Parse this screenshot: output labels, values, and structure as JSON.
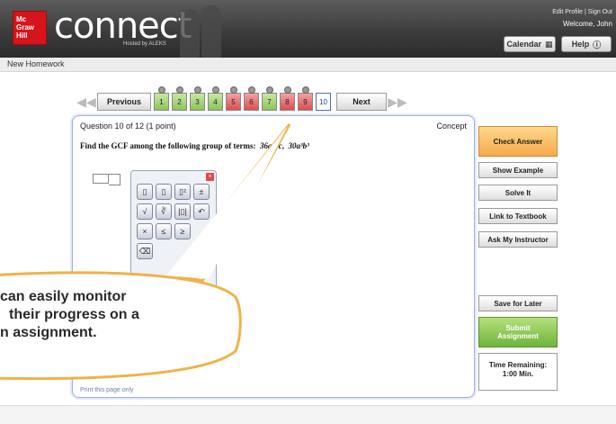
{
  "header": {
    "logo_line1": "Mc",
    "logo_line2": "Graw",
    "logo_line3": "Hill",
    "brand": "connect",
    "hosted": "Hosted by ALEKS",
    "links": "Edit Profile  |  Sign Out",
    "welcome": "Welcome, John",
    "calendar_label": "Calendar",
    "help_label": "Help"
  },
  "page_title": "New Homework",
  "nav": {
    "previous_label": "Previous",
    "next_label": "Next",
    "questions": [
      {
        "num": "1",
        "status": "green",
        "flag": true
      },
      {
        "num": "2",
        "status": "green",
        "flag": true
      },
      {
        "num": "3",
        "status": "green",
        "flag": true
      },
      {
        "num": "4",
        "status": "green",
        "flag": true
      },
      {
        "num": "5",
        "status": "red",
        "flag": true
      },
      {
        "num": "6",
        "status": "red",
        "flag": true
      },
      {
        "num": "7",
        "status": "green",
        "flag": true
      },
      {
        "num": "8",
        "status": "red",
        "flag": true
      },
      {
        "num": "9",
        "status": "red",
        "flag": true
      },
      {
        "num": "10",
        "status": "current",
        "flag": false
      }
    ]
  },
  "question": {
    "number_text": "Question 10 of 12 (1 point)",
    "concept_label": "Concept",
    "prompt": "Find the GCF among the following group of terms:",
    "term1": "36a²bc",
    "term2": "30a³b³",
    "print_link": "Print this page only"
  },
  "sidebar": {
    "check_answer": "Check Answer",
    "show_example": "Show Example",
    "solve_it": "Solve It",
    "link_textbook": "Link to Textbook",
    "ask_instructor": "Ask My Instructor",
    "save_later": "Save for Later",
    "submit_line1": "Submit",
    "submit_line2": "Assignment",
    "time_label": "Time Remaining:",
    "time_value": "1:00 Min."
  },
  "callout": {
    "line1": "can easily monitor",
    "line2": "their progress on a",
    "line3": "n assignment."
  }
}
